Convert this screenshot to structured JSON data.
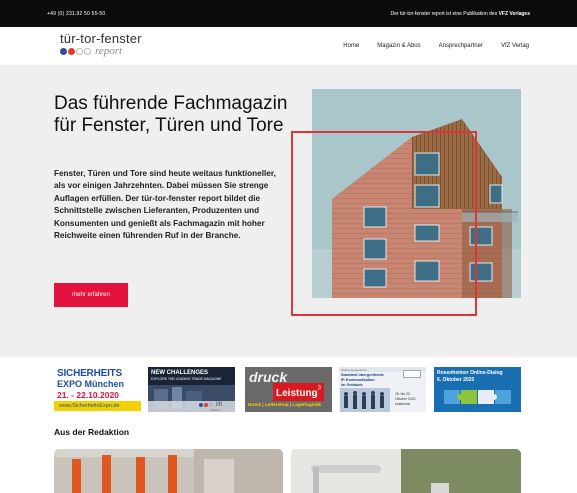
{
  "topbar": {
    "phone": "+49 (0) 231.92 50 55-50",
    "publication_prefix": "Der tür-tor-fenster report ist eine Publikation des ",
    "publication_brand": "VFZ Verlages"
  },
  "logo": {
    "line1": "tür-tor-fenster",
    "line2": "report",
    "dot_colors": [
      "#2f4f9e",
      "#e43b2c",
      "#b8b8b8",
      "#b8b8b8"
    ]
  },
  "nav": {
    "items": [
      "Home",
      "Magazin & Abos",
      "Ansprechpartner",
      "VfZ Verlag"
    ]
  },
  "hero": {
    "title": "Das führende Fachmagazin für Fenster, Türen und Tore",
    "text": "Fenster, Türen und Tore sind heute weitaus funktioneller, als vor einigen Jahrzehnten. Dabei müssen Sie strenge Auflagen erfüllen. Der tür-tor-fenster report bildet die Schnittstelle zwischen Lieferanten, Produzenten und Konsumenten und genießt als Fachmagazin mit hoher Reichweite einen führenden Ruf in der Branche.",
    "button": "mehr erfahren",
    "accent": "#e3123d"
  },
  "banners": {
    "b1": {
      "line1": "SICHERHEITS",
      "line2": "EXPO München",
      "date": "21. - 22.10.2020",
      "url": "www.SicherheitsExpo.de"
    },
    "b2": {
      "line1": "NEW CHALLENGES",
      "line2": "EXPLORE THE LEADING TRADE MAGAZINE",
      "brand": "lift",
      "sub": "report"
    },
    "b3": {
      "word1": "druck",
      "word2": "Leistung",
      "sup": "3",
      "footer": "Druck | Lettershop | Lagerlogistik"
    },
    "b4": {
      "line1": "Online-Symposium",
      "line2": "Standard übergreifende",
      "line3": "IP-Kommunikation",
      "line4": "im Gebäude",
      "date1": "26. bis 30.",
      "date2": "Oktober 2020",
      "date3": "kostenlos!"
    },
    "b5": {
      "line1": "Rosenheimer Online-Dialog",
      "line2": "6. Oktober 2020"
    }
  },
  "section": {
    "title": "Aus der Redaktion"
  }
}
